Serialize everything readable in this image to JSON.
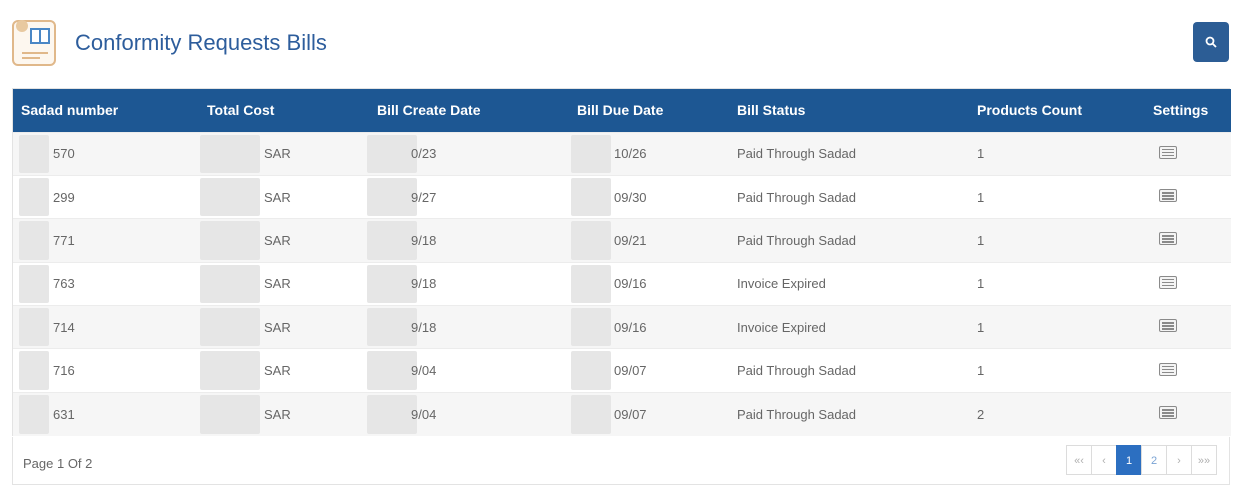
{
  "header": {
    "title": "Conformity Requests Bills",
    "title_icon": "bills-document-icon",
    "search_icon": "search-icon"
  },
  "table": {
    "columns": [
      "Sadad number",
      "Total Cost",
      "Bill Create Date",
      "Bill Due Date",
      "Bill Status",
      "Products Count",
      "Settings"
    ],
    "rows": [
      {
        "sadad": "570",
        "cost": "SAR",
        "created": "0/23",
        "due": "10/26",
        "status": "Paid Through Sadad",
        "count": "1"
      },
      {
        "sadad": "299",
        "cost": "SAR",
        "created": "9/27",
        "due": "09/30",
        "status": "Paid Through Sadad",
        "count": "1"
      },
      {
        "sadad": "771",
        "cost": "SAR",
        "created": "9/18",
        "due": "09/21",
        "status": "Paid Through Sadad",
        "count": "1"
      },
      {
        "sadad": "763",
        "cost": "SAR",
        "created": "9/18",
        "due": "09/16",
        "status": "Invoice Expired",
        "count": "1"
      },
      {
        "sadad": "714",
        "cost": "SAR",
        "created": "9/18",
        "due": "09/16",
        "status": "Invoice Expired",
        "count": "1"
      },
      {
        "sadad": "716",
        "cost": "SAR",
        "created": "9/04",
        "due": "09/07",
        "status": "Paid Through Sadad",
        "count": "1"
      },
      {
        "sadad": "631",
        "cost": "SAR",
        "created": "9/04",
        "due": "09/07",
        "status": "Paid Through Sadad",
        "count": "2"
      }
    ],
    "settings_icon": "details-list-icon"
  },
  "footer": {
    "page_info": "Page 1 Of 2",
    "pager": {
      "first": "«‹",
      "prev": "‹",
      "pages": [
        "1",
        "2"
      ],
      "current": "1",
      "next": "›",
      "last": "»»"
    }
  },
  "colors": {
    "header_bg": "#1d5793",
    "title": "#2d5d9c",
    "accent": "#2c6fc1"
  }
}
